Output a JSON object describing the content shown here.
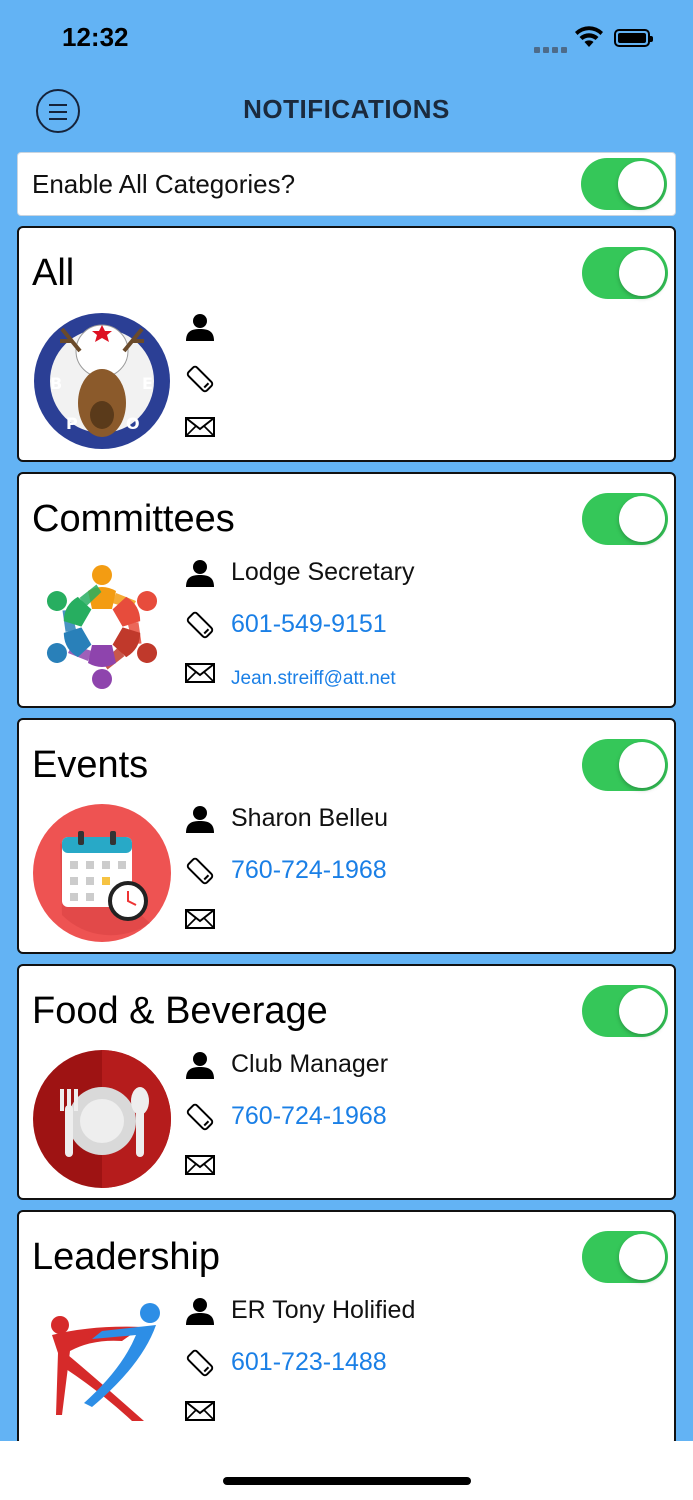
{
  "status_bar": {
    "time": "12:32"
  },
  "header": {
    "title": "NOTIFICATIONS",
    "menu_icon": "menu-icon"
  },
  "enable_all": {
    "label": "Enable All Categories?",
    "enabled": true
  },
  "categories": [
    {
      "name": "All",
      "enabled": true,
      "logo": "elks-emblem",
      "contact": "",
      "phone": "",
      "email": ""
    },
    {
      "name": "Committees",
      "enabled": true,
      "logo": "people-circle",
      "contact": "Lodge Secretary",
      "phone": "601-549-9151",
      "email": "Jean.streiff@att.net"
    },
    {
      "name": "Events",
      "enabled": true,
      "logo": "calendar-clock",
      "contact": "Sharon Belleu",
      "phone": "760-724-1968",
      "email": ""
    },
    {
      "name": "Food & Beverage",
      "enabled": true,
      "logo": "plate-fork-spoon",
      "contact": "Club Manager",
      "phone": "760-724-1968",
      "email": ""
    },
    {
      "name": "Leadership",
      "enabled": true,
      "logo": "leaders-figures",
      "contact": "ER Tony Holified",
      "phone": "601-723-1488",
      "email": ""
    }
  ],
  "colors": {
    "background": "#63b3f4",
    "toggle_on": "#35c759",
    "link": "#1a7fe6"
  }
}
